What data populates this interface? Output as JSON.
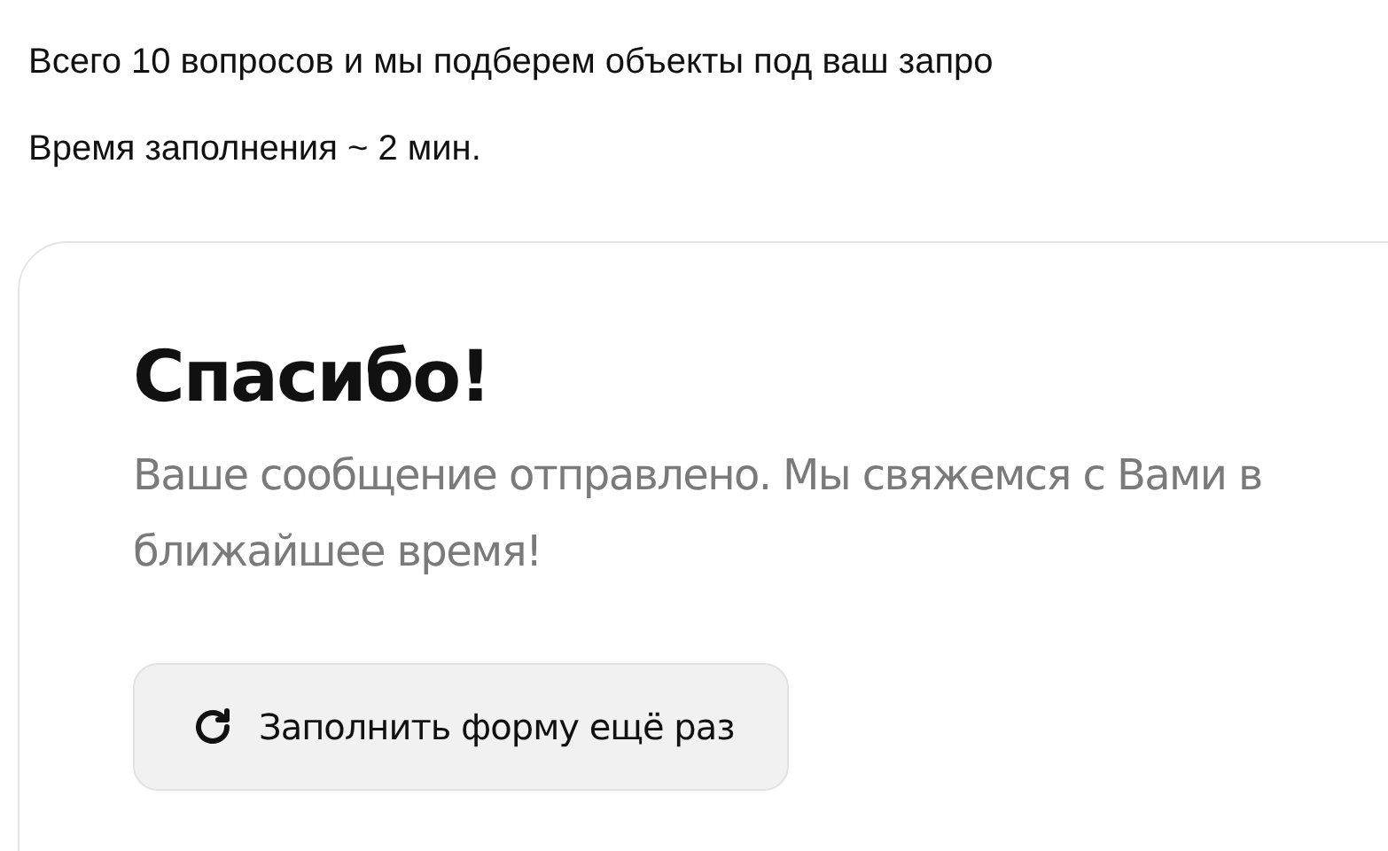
{
  "intro": [
    "Всего 10 вопросов и мы подберем объекты под ваш запро",
    "Время заполнения ~ 2 мин."
  ],
  "card": {
    "title": "Спасибо!",
    "message": "Ваше сообщение отправлено. Мы свяжемся с Вами в ближайшее время!",
    "button": "Заполнить форму ещё раз"
  }
}
